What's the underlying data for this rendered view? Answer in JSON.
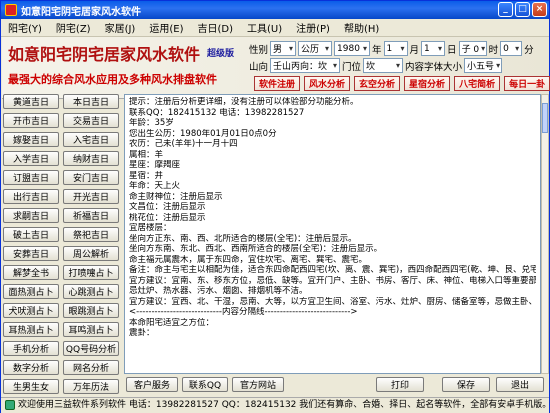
{
  "window": {
    "title": "如意阳宅阴宅居家风水软件"
  },
  "menu": [
    "阳宅(Y)",
    "阴宅(Z)",
    "家居(J)",
    "运用(E)",
    "吉日(D)",
    "工具(U)",
    "注册(P)",
    "帮助(H)"
  ],
  "banner": {
    "title": "如意阳宅阴宅居家风水软件",
    "version": "超级版",
    "slogan": "最强大的综合风水应用及多种风水排盘软件"
  },
  "controls": {
    "gender_label": "性别",
    "gender_value": "男",
    "calendar_value": "公历",
    "year_value": "1980",
    "year_label": "年",
    "month_value": "1",
    "month_label": "月",
    "day_value": "1",
    "day_label": "日",
    "hour_value": "子 0",
    "hour_label": "时",
    "minute_value": "0",
    "minute_label": "分",
    "mountain_label": "山向",
    "mountain_value": "壬山丙向：坎",
    "door_label": "门位",
    "door_value": "坎",
    "font_label": "内容字体大小",
    "font_value": "小五号"
  },
  "tools": [
    "软件注册",
    "风水分析",
    "玄空分析",
    "星宿分析",
    "八宅简析",
    "每日一卦"
  ],
  "left_buttons": [
    "黄道吉日",
    "本日吉日",
    "开市吉日",
    "交易吉日",
    "嫁娶吉日",
    "入宅吉日",
    "入学吉日",
    "纳财吉日",
    "订盟吉日",
    "安门吉日",
    "出行吉日",
    "开光吉日",
    "求嗣吉日",
    "祈福吉日",
    "破土吉日",
    "祭祀吉日",
    "安葬吉日",
    "周公解析",
    "解梦全书",
    "打喷嚏占卜",
    "面热测占卜",
    "心跳测占卜",
    "犬吠测占卜",
    "眼跳测占卜",
    "耳热测占卜",
    "耳鸣测占卜",
    "手机分析",
    "QQ号码分析",
    "数字分析",
    "网名分析",
    "生男生女",
    "万年历法"
  ],
  "content_lines": [
    "提示：注册后分析更详细，没有注册可以体验部分功能分析。",
    "联系QQ：182415132  电话：13982281527",
    "",
    "年龄：35岁",
    "您出生公历：1980年01月01日0点0分",
    "农历：己未(羊年)十一月十四",
    "属相：羊",
    "星座：摩羯座",
    "星宿：井",
    "年命：天上火",
    "命主财神位：注册后显示",
    "文昌位：注册后显示",
    "桃花位：注册后显示",
    "",
    "宜居楼层：",
    "坐向方正东、南、西、北所适合的楼层(全宅)：注册后显示。",
    "坐向方东南、东北、西北、西南所适合的楼层(全宅)：注册后显示。",
    "",
    "命主福元属震木，属于东四命，宜住坎宅、离宅、巽宅、震宅。",
    "备注：命主与宅主以相配为佳，适合东四命配西四宅(坎、离、震、巽宅)，西四命配西四宅(乾、坤、艮、兑宅)的原则。",
    "",
    "宜方建议：宜南、东、移东方位，忌低、缺等。宜开门户、主卧、书房、客厅、床、神位、电梯入口等重要部位，",
    "忌灶炉、热水器、污水、烟囱、排烟机等不洁。",
    "",
    "宜方建议：宜西、北、干湿，忌南、大等，以方宜卫生间、浴室、污水、灶炉、厨房、储备室等，忌做主卧、开门、神位、床等。",
    "",
    "<----------------------------内容分隔线---------------------------->",
    "",
    "本命阳宅适宜之方位：",
    "",
    "震卦："
  ],
  "bottom_buttons": [
    "客户服务",
    "联系QQ",
    "官方网站",
    "打印",
    "保存",
    "退出"
  ],
  "status": "欢迎使用三益软件系列软件  电话：13982281527  QQ：182415132  我们还有算命、合婚、择日、起名等软件，全部有安卓手机版。"
}
